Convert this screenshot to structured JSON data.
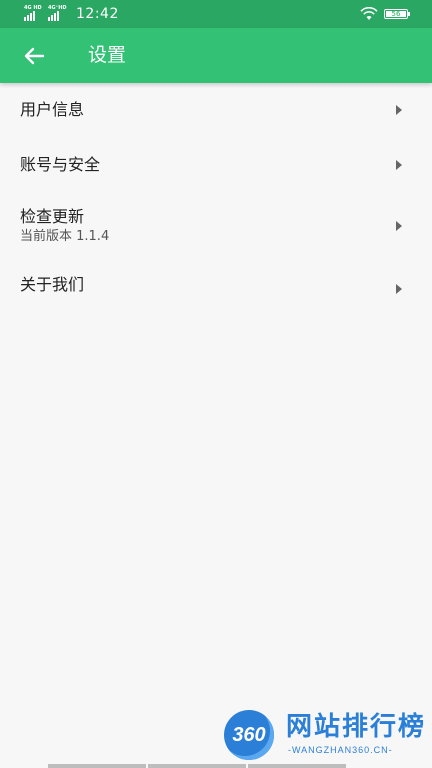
{
  "status_bar": {
    "sim1_label": "4G HD",
    "sim2_label": "4G⁺HD",
    "time": "12:42",
    "battery": "56",
    "icons": [
      "signal-icon",
      "wifi-icon",
      "battery-icon"
    ]
  },
  "toolbar": {
    "title": "设置",
    "back_icon": "arrow-left-icon"
  },
  "settings": {
    "items": [
      {
        "label": "用户信息"
      },
      {
        "label": "账号与安全"
      },
      {
        "label": "检查更新",
        "subtitle": "当前版本 1.1.4"
      },
      {
        "label": "关于我们"
      }
    ]
  },
  "watermark": {
    "number": "360",
    "title": "网站排行榜",
    "subtitle": "-WANGZHAN360.CN-"
  },
  "colors": {
    "status_bar": "#2aa762",
    "toolbar": "#33c176",
    "background": "#f7f7f8",
    "watermark": "#2b7fd6"
  }
}
